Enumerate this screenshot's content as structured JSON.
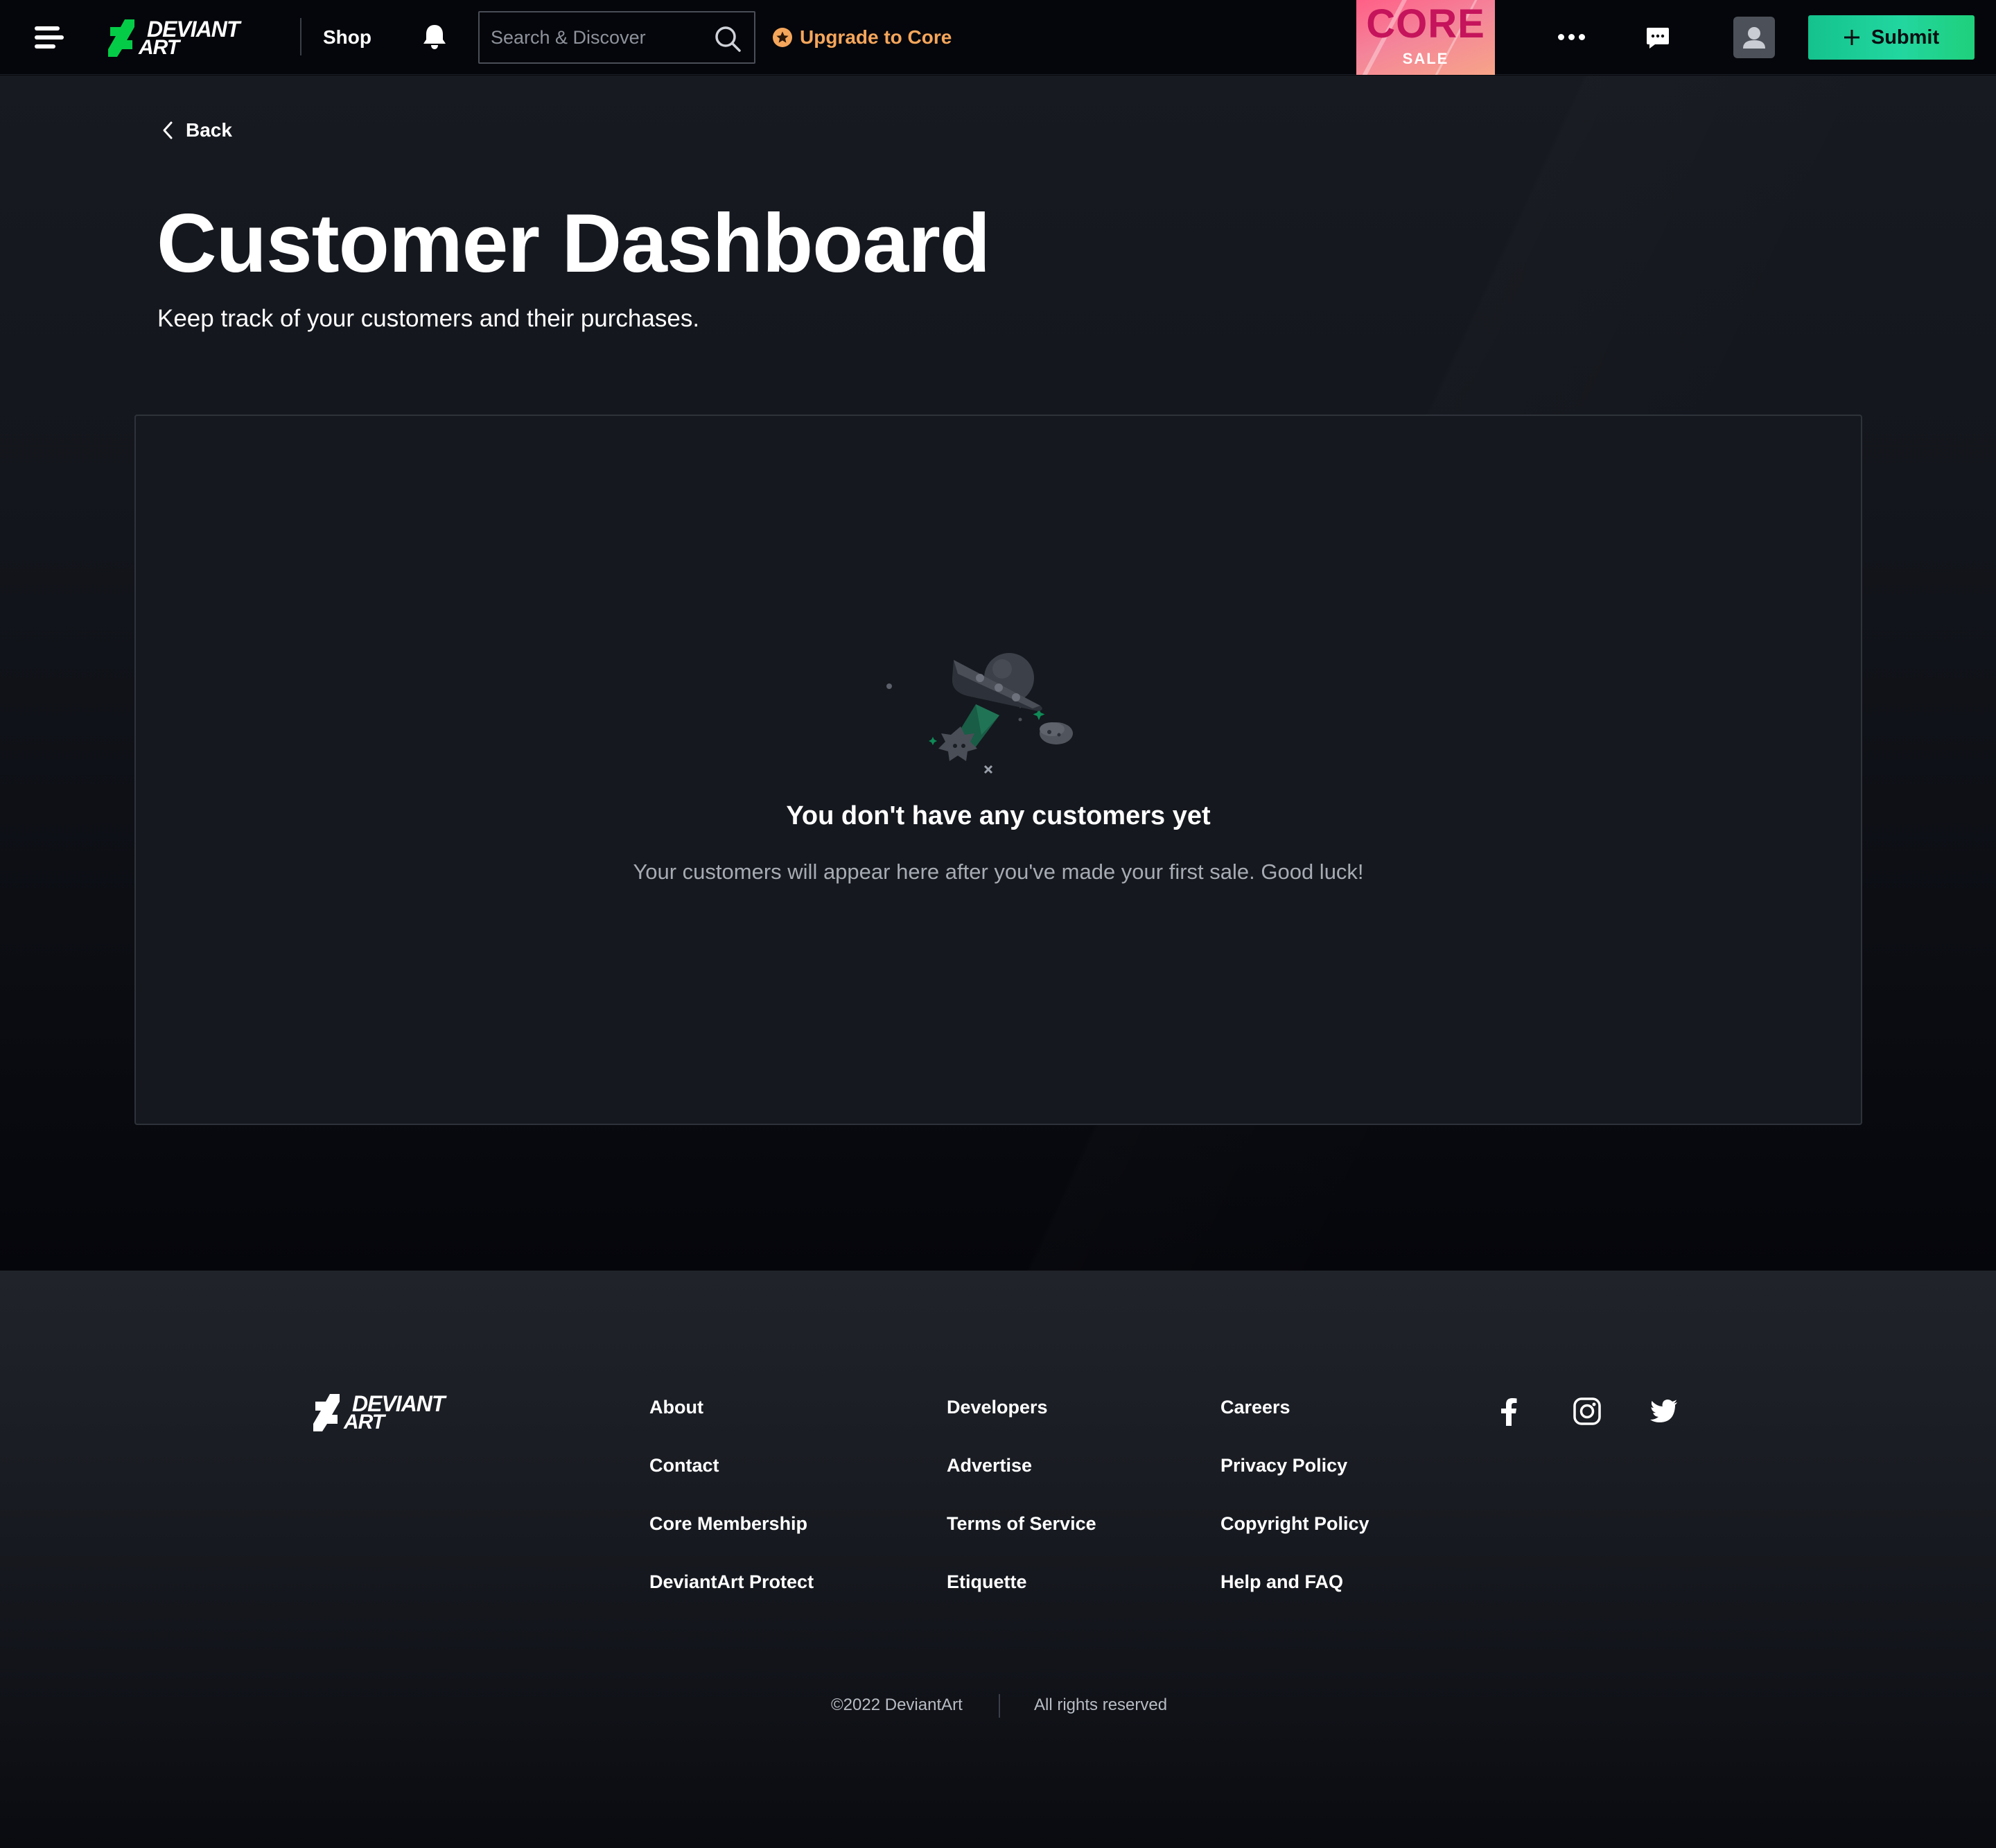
{
  "header": {
    "logo_line1": "DEVIANT",
    "logo_line2": "ART",
    "shop_label": "Shop",
    "search_placeholder": "Search & Discover",
    "upgrade_label": "Upgrade to Core",
    "promo_core": "CORE",
    "promo_sale": "SALE",
    "submit_label": "Submit"
  },
  "main": {
    "back_label": "Back",
    "title": "Customer Dashboard",
    "subtitle": "Keep track of your customers and their purchases.",
    "empty_title": "You don't have any customers yet",
    "empty_description": "Your customers will appear here after you've made your first sale. Good luck!"
  },
  "footer": {
    "logo_line1": "DEVIANT",
    "logo_line2": "ART",
    "columns": [
      [
        "About",
        "Contact",
        "Core Membership",
        "DeviantArt Protect"
      ],
      [
        "Developers",
        "Advertise",
        "Terms of Service",
        "Etiquette"
      ],
      [
        "Careers",
        "Privacy Policy",
        "Copyright Policy",
        "Help and FAQ"
      ]
    ],
    "social": [
      "facebook-icon",
      "instagram-icon",
      "twitter-icon"
    ],
    "copyright": "©2022 DeviantArt",
    "rights": "All rights reserved"
  },
  "colors": {
    "brand_green": "#05cc47",
    "submit_green": "#22d6a0",
    "upgrade_orange": "#f5a65b",
    "promo_pink": "#ff5f86",
    "promo_text": "#c5145b",
    "page_bg": "#06070d",
    "panel_bg": "#15181e"
  }
}
